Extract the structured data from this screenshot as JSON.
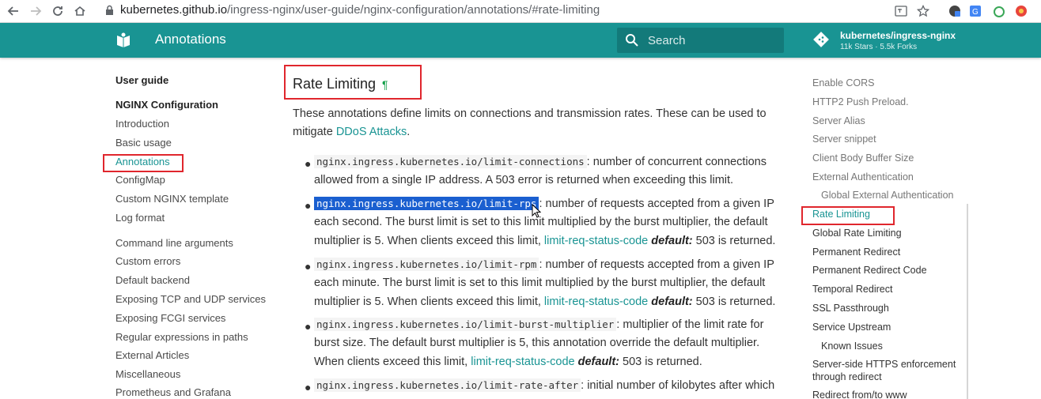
{
  "browser": {
    "url_host": "kubernetes.github.io",
    "url_path": "/ingress-nginx/user-guide/nginx-configuration/annotations/#rate-limiting"
  },
  "header": {
    "title": "Annotations",
    "search_placeholder": "Search",
    "repo_name": "kubernetes/ingress-nginx",
    "repo_stats": "11k Stars · 5.5k Forks"
  },
  "left_nav": {
    "items": [
      "User guide",
      "NGINX Configuration",
      "Introduction",
      "Basic usage",
      "Annotations",
      "ConfigMap",
      "Custom NGINX template",
      "Log format",
      "Command line arguments",
      "Custom errors",
      "Default backend",
      "Exposing TCP and UDP services",
      "Exposing FCGI services",
      "Regular expressions in paths",
      "External Articles",
      "Miscellaneous",
      "Prometheus and Grafana"
    ]
  },
  "content": {
    "heading": "Rate Limiting",
    "pilcrow": "¶",
    "intro_text": "These annotations define limits on connections and transmission rates. These can be used to mitigate ",
    "intro_link": "DDoS Attacks",
    "intro_end": ".",
    "items": [
      {
        "code": "nginx.ingress.kubernetes.io/limit-connections",
        "text": ": number of concurrent connections allowed from a single IP address. A 503 error is returned when exceeding this limit."
      },
      {
        "code": "nginx.ingress.kubernetes.io/limit-rps",
        "text": ": number of requests accepted from a given IP each second. The burst limit is set to this limit multiplied by the burst multiplier, the default multiplier is 5. When clients exceed this limit, ",
        "link": "limit-req-status-code",
        "em": "default:",
        "tail": " 503 is returned."
      },
      {
        "code": "nginx.ingress.kubernetes.io/limit-rpm",
        "text": ": number of requests accepted from a given IP each minute. The burst limit is set to this limit multiplied by the burst multiplier, the default multiplier is 5. When clients exceed this limit, ",
        "link": "limit-req-status-code",
        "em": "default:",
        "tail": " 503 is returned."
      },
      {
        "code": "nginx.ingress.kubernetes.io/limit-burst-multiplier",
        "text": ": multiplier of the limit rate for burst size. The default burst multiplier is 5, this annotation override the default multiplier. When clients exceed this limit, ",
        "link": "limit-req-status-code",
        "em": "default:",
        "tail": " 503 is returned."
      },
      {
        "code": "nginx.ingress.kubernetes.io/limit-rate-after",
        "text": ": initial number of kilobytes after which"
      }
    ]
  },
  "toc": {
    "items": [
      "Enable CORS",
      "HTTP2 Push Preload.",
      "Server Alias",
      "Server snippet",
      "Client Body Buffer Size",
      "External Authentication",
      "Global External Authentication",
      "Rate Limiting",
      "Global Rate Limiting",
      "Permanent Redirect",
      "Permanent Redirect Code",
      "Temporal Redirect",
      "SSL Passthrough",
      "Service Upstream",
      "Known Issues",
      "Server-side HTTPS enforcement",
      "through redirect",
      "Redirect from/to www"
    ]
  },
  "colors": {
    "primary": "#199493",
    "link": "#199493",
    "annotation_box": "#e0262d",
    "selection": "#1a5fd0"
  }
}
